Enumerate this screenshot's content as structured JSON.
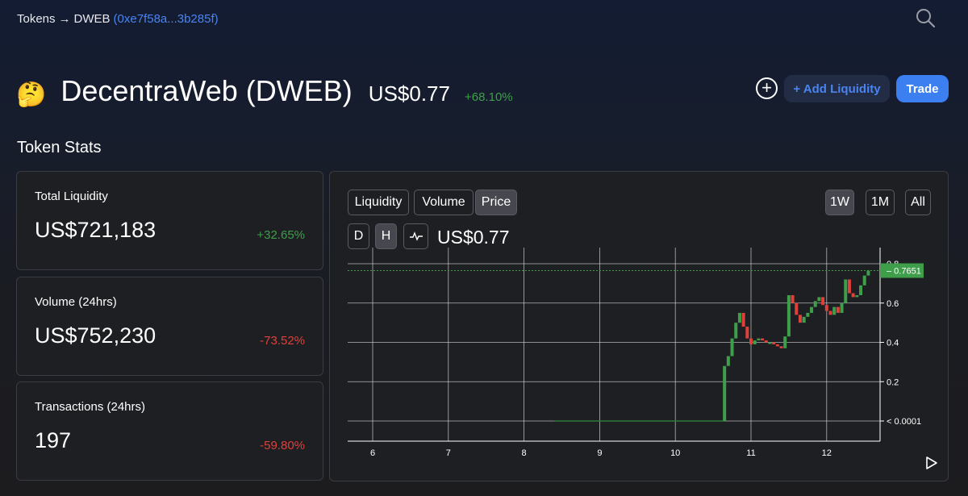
{
  "breadcrumb": {
    "tokens": "Tokens",
    "arrow": "→",
    "current": "DWEB",
    "address": "(0xe7f58a...3b285f)"
  },
  "token": {
    "emoji": "🤔",
    "name": "DecentraWeb (DWEB)",
    "price": "US$0.77",
    "change": "+68.10%"
  },
  "actions": {
    "add_liquidity": "+ Add Liquidity",
    "trade": "Trade",
    "plus": "+"
  },
  "stats_title": "Token Stats",
  "stats": [
    {
      "label": "Total Liquidity",
      "value": "US$721,183",
      "change": "+32.65%"
    },
    {
      "label": "Volume (24hrs)",
      "value": "US$752,230",
      "change": "-73.52%"
    },
    {
      "label": "Transactions (24hrs)",
      "value": "197",
      "change": "-59.80%"
    }
  ],
  "chart_panel": {
    "tabs": [
      "Liquidity",
      "Volume",
      "Price"
    ],
    "active_tab": "Price",
    "ranges": [
      "1W",
      "1M",
      "All"
    ],
    "active_range": "1W",
    "intervals": [
      "D",
      "H"
    ],
    "active_interval": "H",
    "price": "US$0.77"
  },
  "chart_data": {
    "type": "candlestick",
    "x_tick_labels": [
      "6",
      "7",
      "8",
      "9",
      "10",
      "11",
      "12"
    ],
    "y_tick_labels": [
      "< 0.0001",
      "0.2",
      "0.4",
      "0.6",
      "0.8"
    ],
    "ylim": [
      0,
      0.8
    ],
    "current_price_label": "0.7651",
    "current_price": 0.7651,
    "colors": {
      "up": "#3f9e4a",
      "down": "#e0403a",
      "flat": "#2f7a38",
      "price_line": "#3f9e4a",
      "grid": "#d8d8d8"
    },
    "candles": [
      [
        10.65,
        0.0001,
        0.28
      ],
      [
        10.7,
        0.28,
        0.33
      ],
      [
        10.75,
        0.33,
        0.42
      ],
      [
        10.8,
        0.42,
        0.5
      ],
      [
        10.85,
        0.5,
        0.55
      ],
      [
        10.9,
        0.55,
        0.48
      ],
      [
        10.95,
        0.48,
        0.42
      ],
      [
        11.0,
        0.42,
        0.39
      ],
      [
        11.05,
        0.39,
        0.41
      ],
      [
        11.1,
        0.41,
        0.42
      ],
      [
        11.15,
        0.42,
        0.41
      ],
      [
        11.2,
        0.41,
        0.4
      ],
      [
        11.25,
        0.4,
        0.4
      ],
      [
        11.3,
        0.4,
        0.39
      ],
      [
        11.35,
        0.39,
        0.38
      ],
      [
        11.4,
        0.38,
        0.37
      ],
      [
        11.45,
        0.37,
        0.43
      ],
      [
        11.5,
        0.43,
        0.64
      ],
      [
        11.55,
        0.64,
        0.6
      ],
      [
        11.6,
        0.6,
        0.54
      ],
      [
        11.65,
        0.54,
        0.5
      ],
      [
        11.7,
        0.5,
        0.53
      ],
      [
        11.75,
        0.53,
        0.55
      ],
      [
        11.8,
        0.55,
        0.58
      ],
      [
        11.85,
        0.58,
        0.61
      ],
      [
        11.9,
        0.61,
        0.63
      ],
      [
        11.95,
        0.63,
        0.59
      ],
      [
        12.0,
        0.59,
        0.56
      ],
      [
        12.05,
        0.56,
        0.54
      ],
      [
        12.1,
        0.54,
        0.58
      ],
      [
        12.15,
        0.58,
        0.55
      ],
      [
        12.2,
        0.55,
        0.6
      ],
      [
        12.25,
        0.6,
        0.72
      ],
      [
        12.3,
        0.72,
        0.65
      ],
      [
        12.35,
        0.65,
        0.63
      ],
      [
        12.4,
        0.63,
        0.64
      ],
      [
        12.45,
        0.64,
        0.69
      ],
      [
        12.5,
        0.69,
        0.74
      ],
      [
        12.55,
        0.74,
        0.7651
      ]
    ],
    "flat_segment": [
      8.4,
      10.65,
      0.0001
    ]
  }
}
